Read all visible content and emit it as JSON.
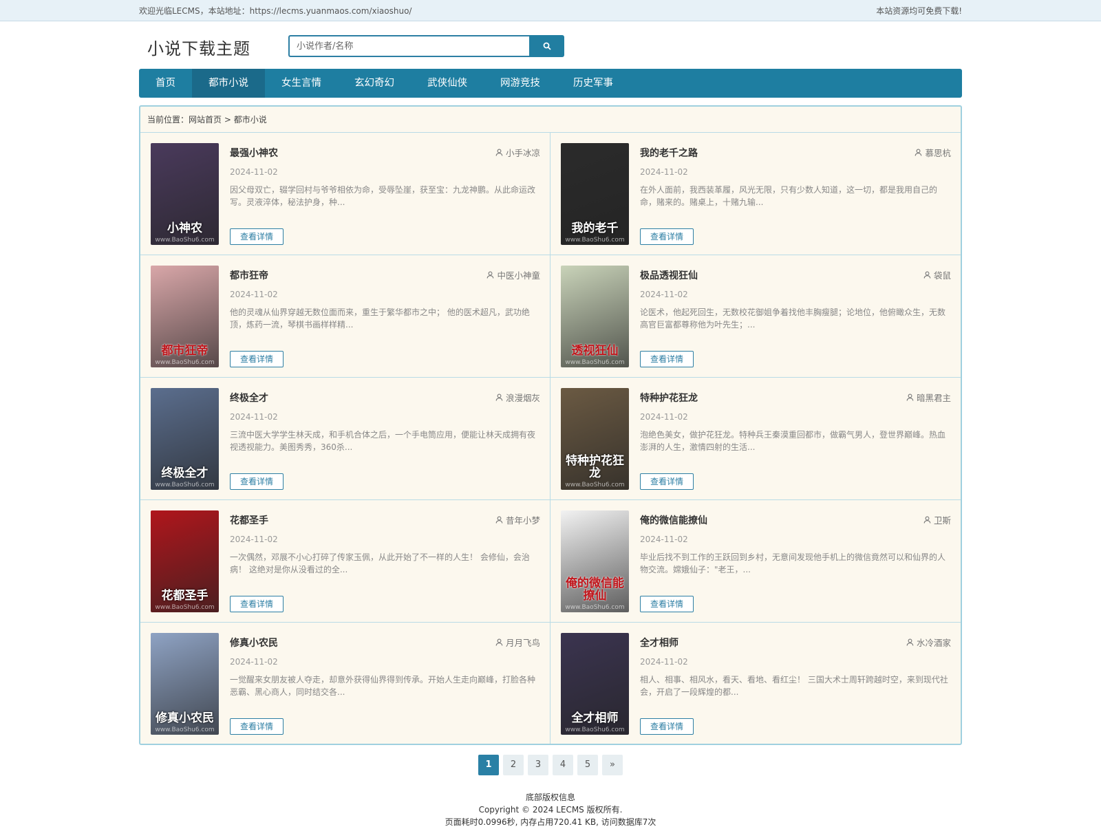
{
  "topbar": {
    "welcome": "欢迎光临LECMS，本站地址：https://lecms.yuanmaos.com/xiaoshuo/",
    "notice": "本站资源均可免费下载!"
  },
  "header": {
    "logo": "小说下载主题",
    "search_placeholder": "小说作者/名称"
  },
  "nav": [
    {
      "label": "首页"
    },
    {
      "label": "都市小说"
    },
    {
      "label": "女生言情"
    },
    {
      "label": "玄幻奇幻"
    },
    {
      "label": "武侠仙侠"
    },
    {
      "label": "网游竞技"
    },
    {
      "label": "历史军事"
    }
  ],
  "breadcrumb": {
    "prefix": "当前位置：",
    "home": "网站首页",
    "sep": " > ",
    "current": "都市小说"
  },
  "detail_label": "查看详情",
  "books": [
    {
      "title": "最强小神农",
      "author": "小手冰凉",
      "date": "2024-11-02",
      "desc": "因父母双亡，辍学回村与爷爷相依为命，受辱坠崖，获至宝：九龙神鹏。从此命运改写。灵液淬体，秘法护身，种...",
      "cover_text": "小神农",
      "cover_color": "#4a3a5c"
    },
    {
      "title": "我的老千之路",
      "author": "慕思杭",
      "date": "2024-11-02",
      "desc": "在外人面前，我西装革履，风光无限，只有少数人知道，这一切，都是我用自己的命，赌来的。赌桌上，十赌九输...",
      "cover_text": "我的老千",
      "cover_color": "#2b2b2b"
    },
    {
      "title": "都市狂帝",
      "author": "中医小神童",
      "date": "2024-11-02",
      "desc": "他的灵魂从仙界穿越无数位面而来，重生于繁华都市之中； 他的医术超凡，武功绝顶，炼药一流，琴棋书画样样精...",
      "cover_text": "都市狂帝",
      "cover_color": "#d9a7a9"
    },
    {
      "title": "极品透视狂仙",
      "author": "袋鼠",
      "date": "2024-11-02",
      "desc": "论医术，他起死回生，无数校花御姐争着找他丰胸瘦腿；论地位，他俯瞰众生，无数高官巨富都尊称他为叶先生；...",
      "cover_text": "透视狂仙",
      "cover_color": "#c9d3b9"
    },
    {
      "title": "终极全才",
      "author": "浪漫烟灰",
      "date": "2024-11-02",
      "desc": "三流中医大学学生林天成，和手机合体之后，一个手电筒应用，便能让林天成拥有夜视透视能力。美图秀秀，360杀...",
      "cover_text": "终极全才",
      "cover_color": "#5b6e8e"
    },
    {
      "title": "特种护花狂龙",
      "author": "暗黑君主",
      "date": "2024-11-02",
      "desc": "泡绝色美女，做护花狂龙。特种兵王秦漠重回都市，做霸气男人，登世界巅峰。热血澎湃的人生，激情四射的生活...",
      "cover_text": "特种护花狂龙",
      "cover_color": "#6b5a43"
    },
    {
      "title": "花都圣手",
      "author": "昔年小梦",
      "date": "2024-11-02",
      "desc": "一次偶然，邓展不小心打碎了传家玉佩，从此开始了不一样的人生！ 会修仙，会治病！ 这绝对是你从没看过的全...",
      "cover_text": "花都圣手",
      "cover_color": "#b0161c"
    },
    {
      "title": "俺的微信能撩仙",
      "author": "卫斯",
      "date": "2024-11-02",
      "desc": "毕业后找不到工作的王跃回到乡村，无意间发现他手机上的微信竟然可以和仙界的人物交流。嫦娥仙子：\"老王，...",
      "cover_text": "俺的微信能撩仙",
      "cover_color": "#f2f2f2"
    },
    {
      "title": "修真小农民",
      "author": "月月飞鸟",
      "date": "2024-11-02",
      "desc": "一觉醒来女朋友被人夺走，却意外获得仙界得到传承。开始人生走向巅峰，打脸各种恶霸、黑心商人，同时结交各...",
      "cover_text": "修真小农民",
      "cover_color": "#8fa3c4"
    },
    {
      "title": "全才相师",
      "author": "水冷酒家",
      "date": "2024-11-02",
      "desc": "相人、相事、相风水，看天、看地、看红尘！ 三国大术士周轩跨越时空，来到现代社会，开启了一段辉煌的都...",
      "cover_text": "全才相师",
      "cover_color": "#3b3450"
    }
  ],
  "pagination": [
    "1",
    "2",
    "3",
    "4",
    "5",
    "»"
  ],
  "footer": {
    "line1": "底部版权信息",
    "line2": "Copyright © 2024 LECMS 版权所有.",
    "line3": "页面耗时0.0996秒, 内存占用720.41 KB, 访问数据库7次"
  },
  "cover_watermark": "www.BaoShu6.com"
}
